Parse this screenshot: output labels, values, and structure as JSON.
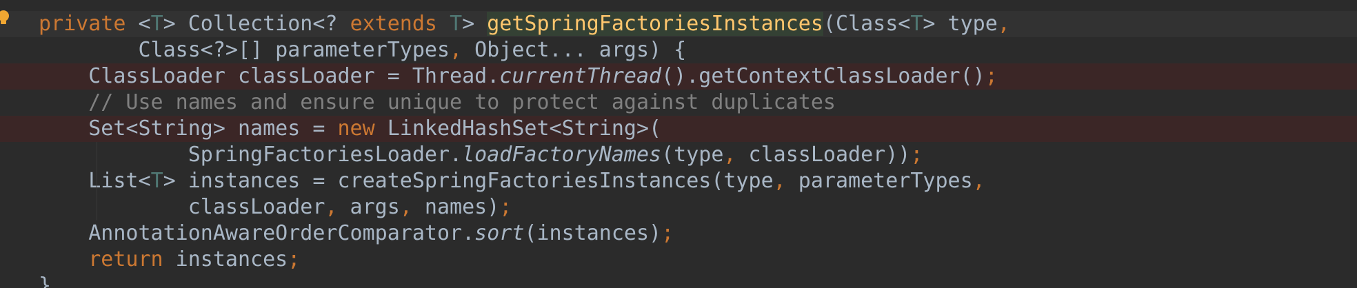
{
  "editor": {
    "intention_icon": "lightbulb-icon",
    "colors": {
      "background": "#2b2b2b",
      "keyword": "#cc7832",
      "method_declaration": "#ffc66d",
      "type_parameter": "#507874",
      "comment": "#808080",
      "text": "#a9b7c6",
      "error_line": "#3b2626",
      "caret_line": "#323232",
      "lightbulb": "#f0a732"
    },
    "lines": [
      {
        "bg": "current",
        "tokens": [
          {
            "t": "private",
            "c": "keyword"
          },
          {
            "t": " <",
            "c": "plain"
          },
          {
            "t": "T",
            "c": "type-param"
          },
          {
            "t": "> Collection<? ",
            "c": "plain"
          },
          {
            "t": "extends",
            "c": "keyword"
          },
          {
            "t": " ",
            "c": "plain"
          },
          {
            "t": "T",
            "c": "type-param"
          },
          {
            "t": "> ",
            "c": "plain"
          },
          {
            "t": "getSpringFactoriesInstances",
            "c": "method-decl"
          },
          {
            "t": "(Class<",
            "c": "plain"
          },
          {
            "t": "T",
            "c": "type-param"
          },
          {
            "t": "> type",
            "c": "plain"
          },
          {
            "t": ",",
            "c": "punct"
          }
        ]
      },
      {
        "bg": "none",
        "tokens": [
          {
            "t": "        Class<?>[] parameterTypes",
            "c": "plain"
          },
          {
            "t": ",",
            "c": "punct"
          },
          {
            "t": " Object... args) {",
            "c": "plain"
          }
        ]
      },
      {
        "bg": "error",
        "tokens": [
          {
            "t": "    ClassLoader classLoader = Thread.",
            "c": "plain"
          },
          {
            "t": "currentThread",
            "c": "static"
          },
          {
            "t": "().getContextClassLoader()",
            "c": "plain"
          },
          {
            "t": ";",
            "c": "punct"
          }
        ]
      },
      {
        "bg": "none",
        "tokens": [
          {
            "t": "    // Use names and ensure unique to protect against duplicates",
            "c": "comment"
          }
        ]
      },
      {
        "bg": "error",
        "tokens": [
          {
            "t": "    Set<String> names = ",
            "c": "plain"
          },
          {
            "t": "new",
            "c": "keyword"
          },
          {
            "t": " LinkedHashSet<String>(",
            "c": "plain"
          }
        ]
      },
      {
        "bg": "none",
        "tokens": [
          {
            "t": "            SpringFactoriesLoader.",
            "c": "plain"
          },
          {
            "t": "loadFactoryNames",
            "c": "static"
          },
          {
            "t": "(type",
            "c": "plain"
          },
          {
            "t": ",",
            "c": "punct"
          },
          {
            "t": " classLoader))",
            "c": "plain"
          },
          {
            "t": ";",
            "c": "punct"
          }
        ]
      },
      {
        "bg": "none",
        "tokens": [
          {
            "t": "    List<",
            "c": "plain"
          },
          {
            "t": "T",
            "c": "type-param"
          },
          {
            "t": "> instances = createSpringFactoriesInstances(type",
            "c": "plain"
          },
          {
            "t": ",",
            "c": "punct"
          },
          {
            "t": " parameterTypes",
            "c": "plain"
          },
          {
            "t": ",",
            "c": "punct"
          }
        ]
      },
      {
        "bg": "none",
        "tokens": [
          {
            "t": "            classLoader",
            "c": "plain"
          },
          {
            "t": ",",
            "c": "punct"
          },
          {
            "t": " args",
            "c": "plain"
          },
          {
            "t": ",",
            "c": "punct"
          },
          {
            "t": " names)",
            "c": "plain"
          },
          {
            "t": ";",
            "c": "punct"
          }
        ]
      },
      {
        "bg": "none",
        "tokens": [
          {
            "t": "    AnnotationAwareOrderComparator.",
            "c": "plain"
          },
          {
            "t": "sort",
            "c": "static"
          },
          {
            "t": "(instances)",
            "c": "plain"
          },
          {
            "t": ";",
            "c": "punct"
          }
        ]
      },
      {
        "bg": "none",
        "tokens": [
          {
            "t": "    ",
            "c": "plain"
          },
          {
            "t": "return",
            "c": "keyword"
          },
          {
            "t": " instances",
            "c": "plain"
          },
          {
            "t": ";",
            "c": "punct"
          }
        ]
      },
      {
        "bg": "none",
        "tokens": [
          {
            "t": "}",
            "c": "plain"
          }
        ]
      }
    ]
  }
}
